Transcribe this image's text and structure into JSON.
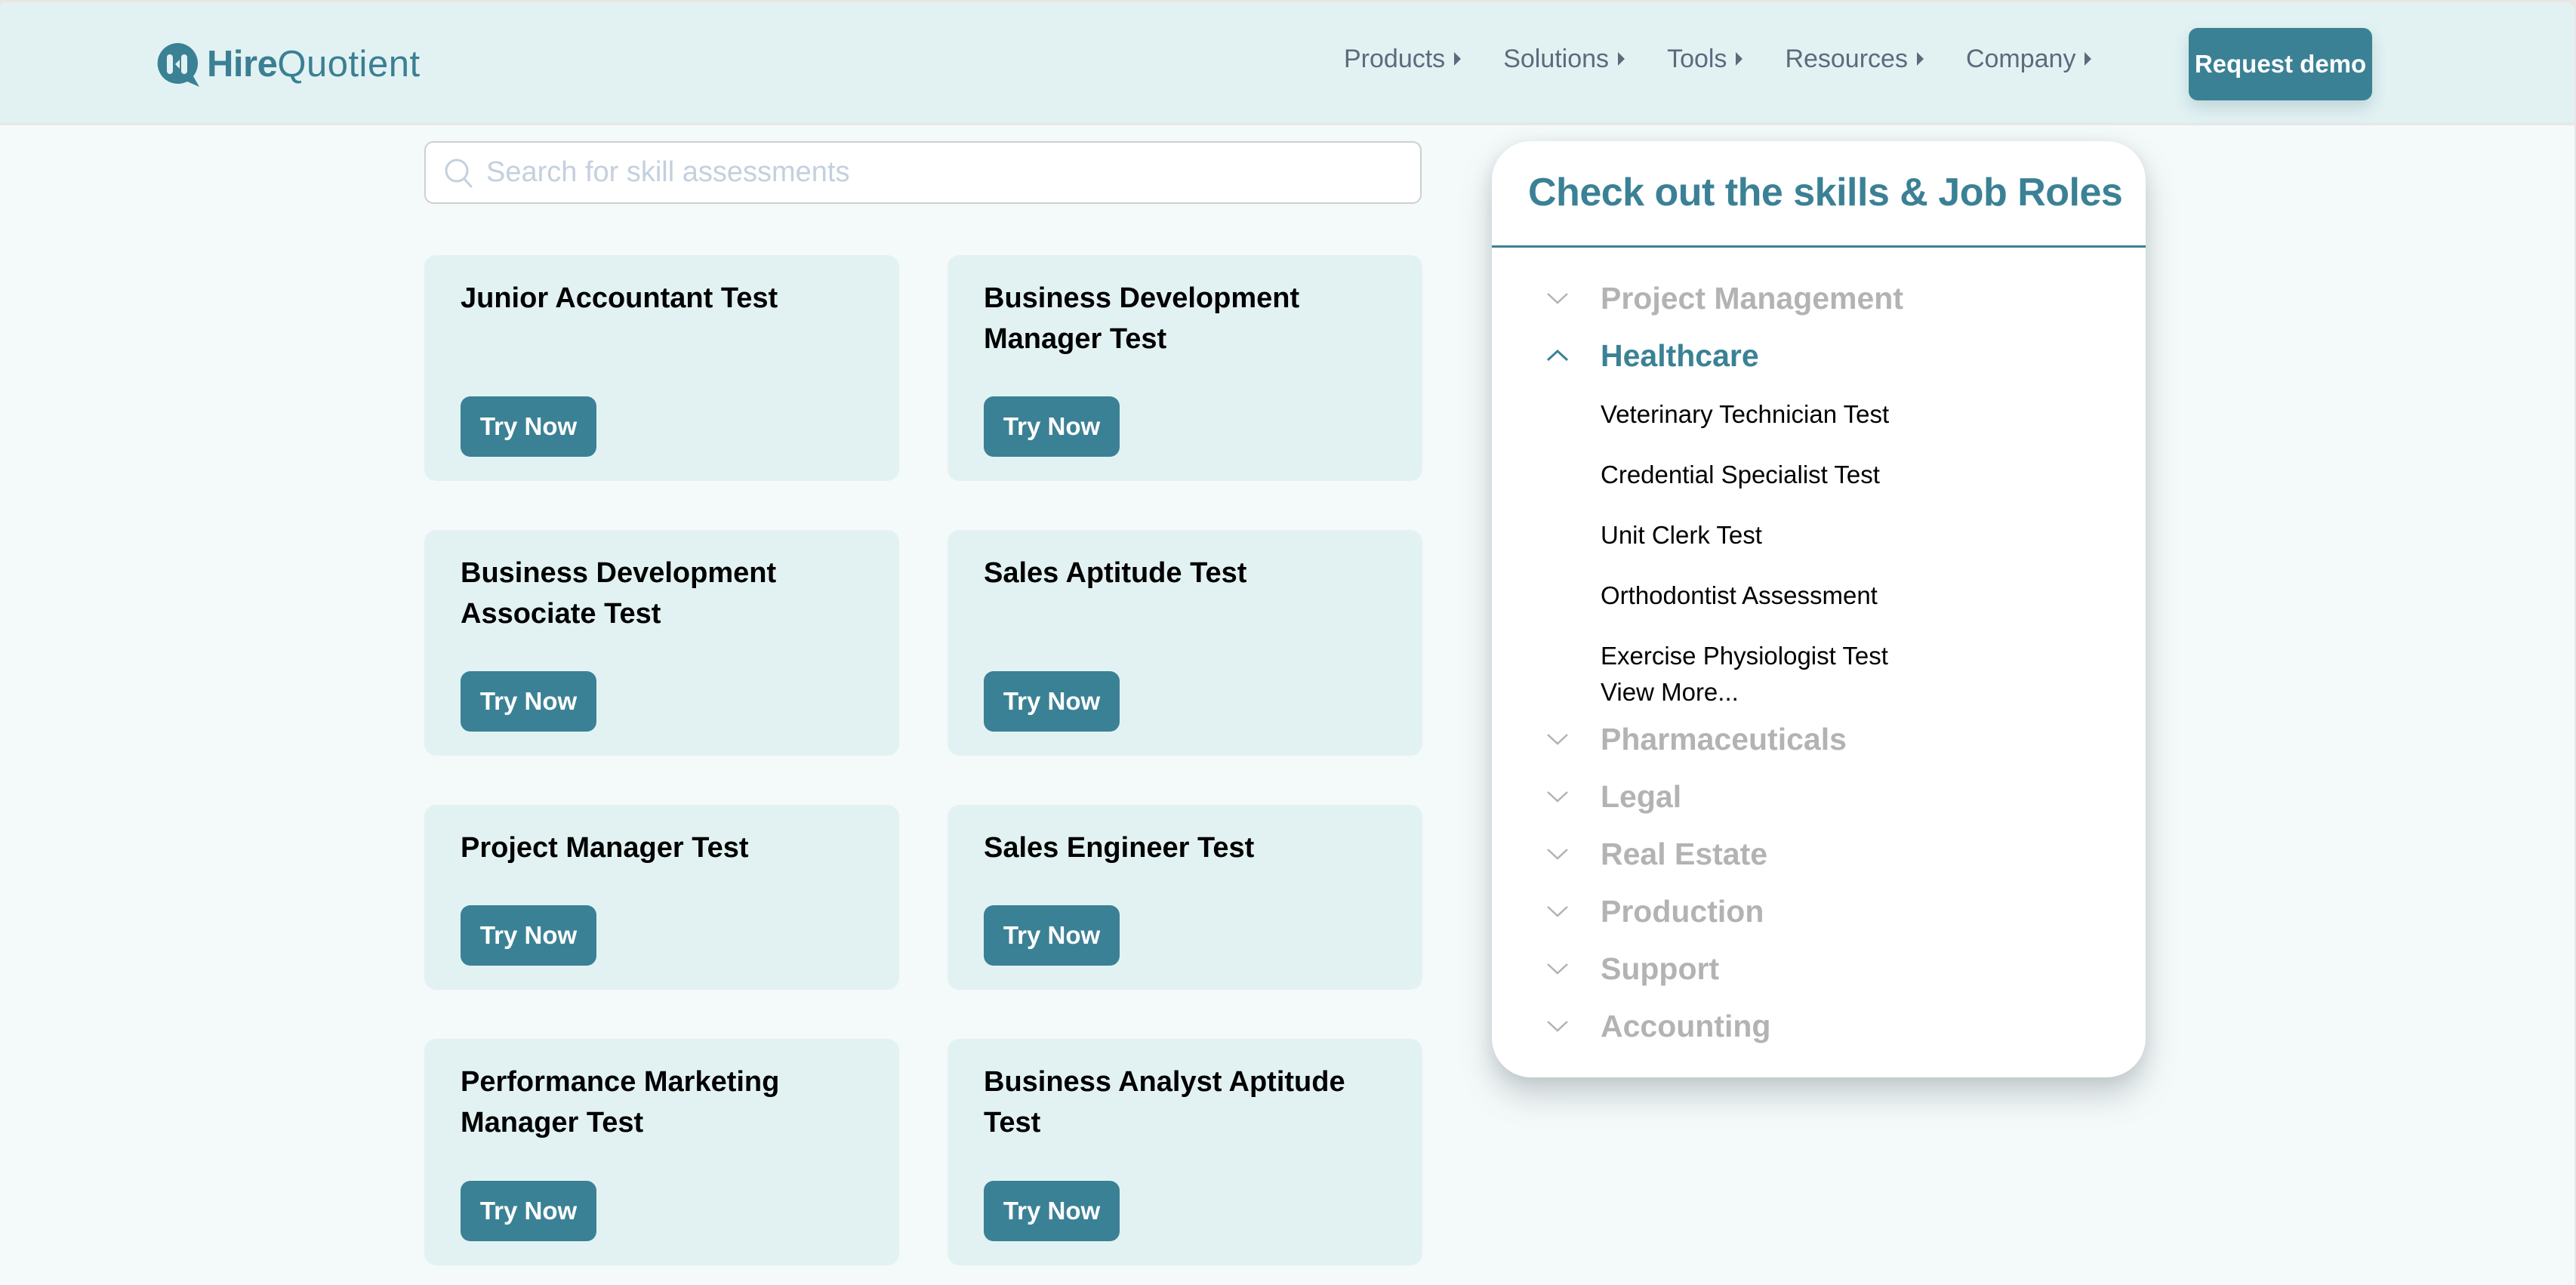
{
  "brand": {
    "name_bold": "Hire",
    "name_light": "Quotient",
    "accent_color": "#3b8195"
  },
  "nav": {
    "items": [
      {
        "label": "Products",
        "icon": "caret-right-icon"
      },
      {
        "label": "Solutions",
        "icon": "caret-right-icon"
      },
      {
        "label": "Tools",
        "icon": "caret-right-icon"
      },
      {
        "label": "Resources",
        "icon": "caret-right-icon"
      },
      {
        "label": "Company",
        "icon": "caret-right-icon"
      }
    ],
    "cta_label": "Request demo"
  },
  "search": {
    "placeholder": "Search for skill assessments",
    "value": "",
    "icon": "search-icon"
  },
  "cards": [
    {
      "title": "Junior Accountant Test",
      "button": "Try Now"
    },
    {
      "title": "Business Development Manager Test",
      "button": "Try Now"
    },
    {
      "title": "Business Development Associate Test",
      "button": "Try Now"
    },
    {
      "title": "Sales Aptitude Test",
      "button": "Try Now"
    },
    {
      "title": "Project Manager Test",
      "button": "Try Now"
    },
    {
      "title": "Sales Engineer Test",
      "button": "Try Now"
    },
    {
      "title": "Performance Marketing Manager Test",
      "button": "Try Now"
    },
    {
      "title": "Business Analyst Aptitude Test",
      "button": "Try Now"
    }
  ],
  "panel": {
    "title": "Check out the skills & Job Roles",
    "categories": [
      {
        "label": "Project Management",
        "expanded": false
      },
      {
        "label": "Healthcare",
        "expanded": true,
        "items": [
          "Veterinary Technician Test",
          "Credential Specialist Test",
          "Unit Clerk Test",
          "Orthodontist Assessment",
          "Exercise Physiologist Test"
        ],
        "view_more": "View More..."
      },
      {
        "label": "Pharmaceuticals",
        "expanded": false
      },
      {
        "label": "Legal",
        "expanded": false
      },
      {
        "label": "Real Estate",
        "expanded": false
      },
      {
        "label": "Production",
        "expanded": false
      },
      {
        "label": "Support",
        "expanded": false
      },
      {
        "label": "Accounting",
        "expanded": false
      }
    ]
  }
}
